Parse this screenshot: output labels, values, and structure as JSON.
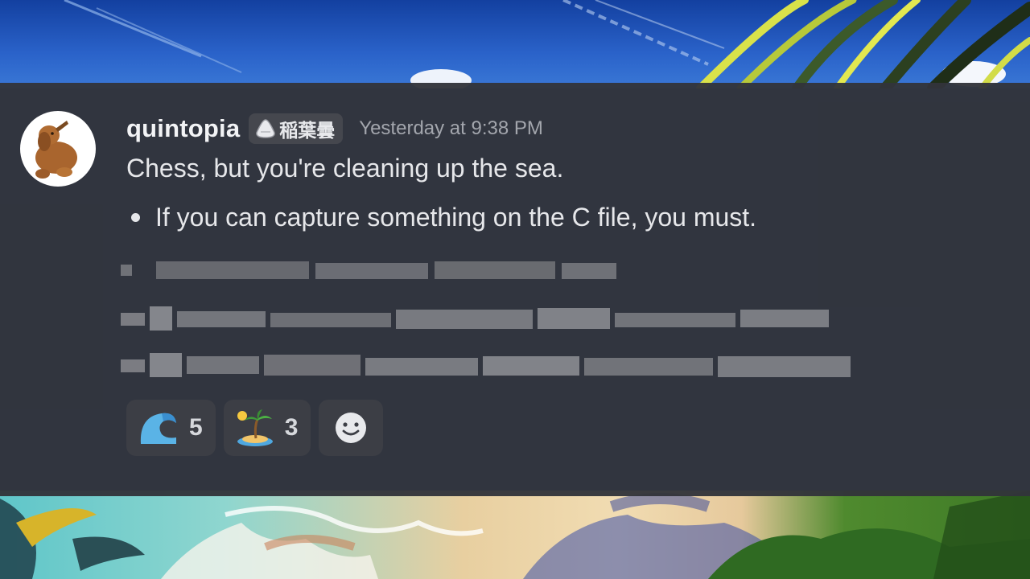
{
  "message": {
    "username": "quintopia",
    "tag_label": "稲葉曇",
    "timestamp": "Yesterday at 9:38 PM",
    "text": "Chess, but you're cleaning up the sea.",
    "bullets": [
      "If you can capture something on the C file, you must."
    ],
    "redacted_line_count": 3
  },
  "reactions": [
    {
      "icon": "wave-emoji-icon",
      "count": "5"
    },
    {
      "icon": "island-emoji-icon",
      "count": "3"
    }
  ],
  "add_reaction_icon": "smiley-add-reaction-icon",
  "colors": {
    "panel_bg": "#32343a",
    "username": "#f2f3f5",
    "timestamp": "#a3a6ad",
    "reaction_bg": "#3c3e45"
  }
}
